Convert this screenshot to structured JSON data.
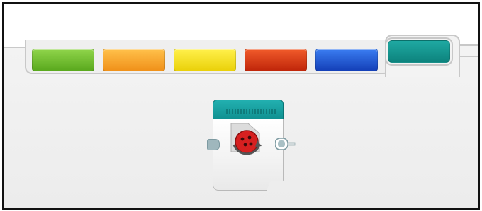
{
  "palette": {
    "tabs": [
      {
        "id": "action",
        "color": "#6cbf2a",
        "active": false
      },
      {
        "id": "flow-control",
        "color": "#f5a21a",
        "active": false
      },
      {
        "id": "sensor",
        "color": "#f2dc11",
        "active": false
      },
      {
        "id": "data-operations",
        "color": "#d8310c",
        "active": false
      },
      {
        "id": "advanced",
        "color": "#1d4fcd",
        "active": false
      },
      {
        "id": "my-blocks",
        "color": "#11968f",
        "active": true
      }
    ]
  },
  "block": {
    "header_color": "#1aa3a3",
    "icon": "motor-rotation-icon"
  }
}
